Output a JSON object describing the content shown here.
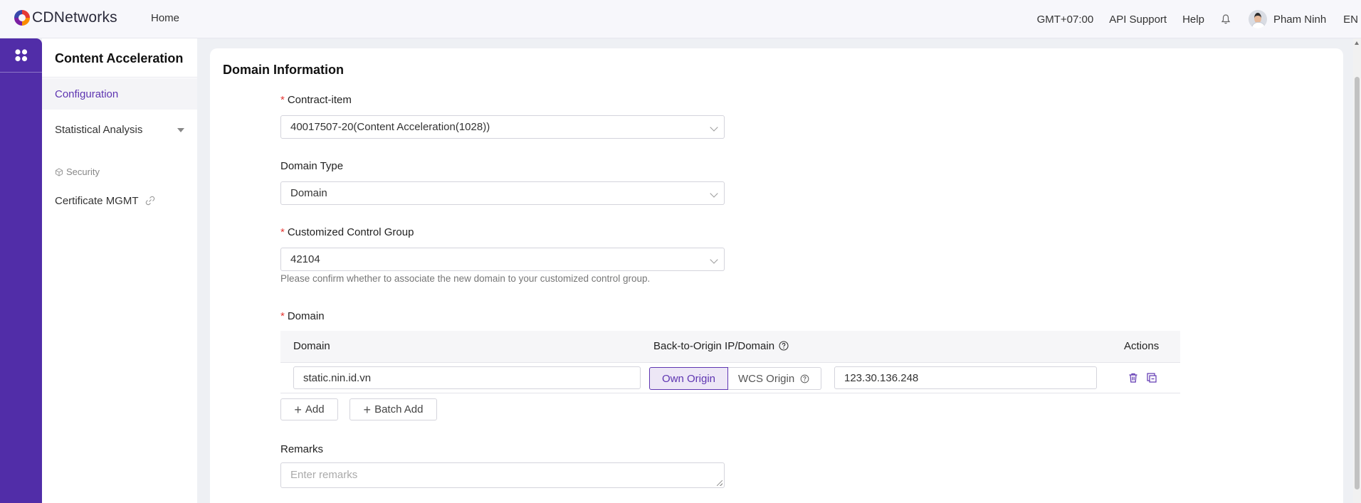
{
  "header": {
    "brand": "CDNetworks",
    "nav_home": "Home",
    "timezone": "GMT+07:00",
    "api_support": "API Support",
    "help": "Help",
    "user_name": "Pham Ninh",
    "language": "EN"
  },
  "sidebar": {
    "title": "Content Acceleration",
    "configuration": "Configuration",
    "statistical_analysis": "Statistical Analysis",
    "security_section": "Security",
    "certificate_mgmt": "Certificate MGMT"
  },
  "form": {
    "card_title": "Domain Information",
    "contract_item_label": "Contract-item",
    "contract_item_value": "40017507-20(Content Acceleration(1028))",
    "domain_type_label": "Domain Type",
    "domain_type_value": "Domain",
    "control_group_label": "Customized Control Group",
    "control_group_value": "42104",
    "control_group_hint": "Please confirm whether to associate the new domain to your customized control group.",
    "domain_label": "Domain",
    "table": {
      "col_domain": "Domain",
      "col_origin": "Back-to-Origin IP/Domain",
      "col_actions": "Actions",
      "row": {
        "domain_value": "static.nin.id.vn",
        "own_origin": "Own Origin",
        "wcs_origin": "WCS Origin",
        "origin_value": "123.30.136.248"
      }
    },
    "add_label": "Add",
    "batch_add_label": "Batch Add",
    "remarks_label": "Remarks",
    "remarks_placeholder": "Enter remarks"
  },
  "colors": {
    "brand_purple": "#512da8",
    "accent": "#5e35b1",
    "required": "#e53935"
  }
}
